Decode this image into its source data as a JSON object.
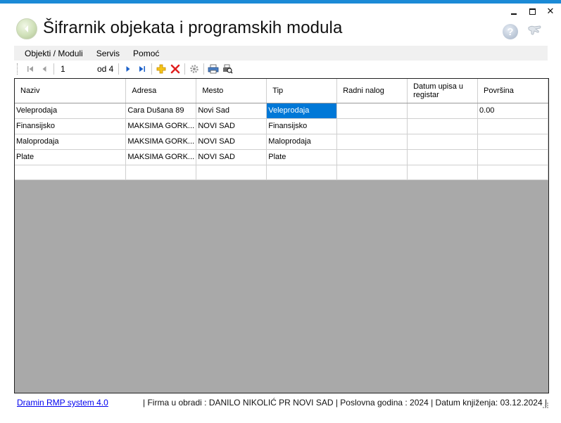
{
  "window": {
    "title": "Šifrarnik objekata i programskih modula",
    "controls": {
      "minimize": "minimize",
      "maximize": "maximize",
      "close": "✕"
    }
  },
  "menu": {
    "items": [
      "Objekti / Moduli",
      "Servis",
      "Pomoć"
    ]
  },
  "navigator": {
    "position": "1",
    "of_label": "od 4"
  },
  "grid": {
    "columns": [
      "Naziv",
      "Adresa",
      "Mesto",
      "Tip",
      "Radni nalog",
      "Datum upisa u registar",
      "Površina"
    ],
    "rows": [
      [
        "Veleprodaja",
        "Cara Dušana 89",
        "Novi Sad",
        "Veleprodaja",
        "",
        "",
        "0.00"
      ],
      [
        "Finansijsko",
        "MAKSIMA GORK...",
        "NOVI SAD",
        "Finansijsko",
        "",
        "",
        ""
      ],
      [
        "Maloprodaja",
        "MAKSIMA GORK...",
        "NOVI SAD",
        "Maloprodaja",
        "",
        "",
        ""
      ],
      [
        "Plate",
        "MAKSIMA GORK...",
        "NOVI SAD",
        "Plate",
        "",
        "",
        ""
      ]
    ],
    "selected_cell": {
      "row": 0,
      "column": 3
    }
  },
  "status": {
    "link": "Dramin RMP system 4.0",
    "text": "|  Firma u obradi : DANILO NIKOLIĆ PR NOVI SAD  |  Poslovna godina : 2024  |  Datum knjiženja: 03.12.2024  |"
  },
  "colors": {
    "accent": "#1b8ad6",
    "selection": "#0078d7",
    "empty_grid": "#a9a9a9",
    "menubar": "#f0f0f0",
    "link": "#0000ee"
  },
  "icons": {
    "back": "back-arrow-icon",
    "help": "help-icon",
    "tools": "wrench-hand-icon",
    "first": "first-record-icon",
    "prev": "previous-record-icon",
    "next": "next-record-icon",
    "last": "last-record-icon",
    "add": "add-icon",
    "delete": "delete-icon",
    "settings": "gear-icon",
    "print": "print-icon",
    "print_preview": "print-preview-icon"
  }
}
